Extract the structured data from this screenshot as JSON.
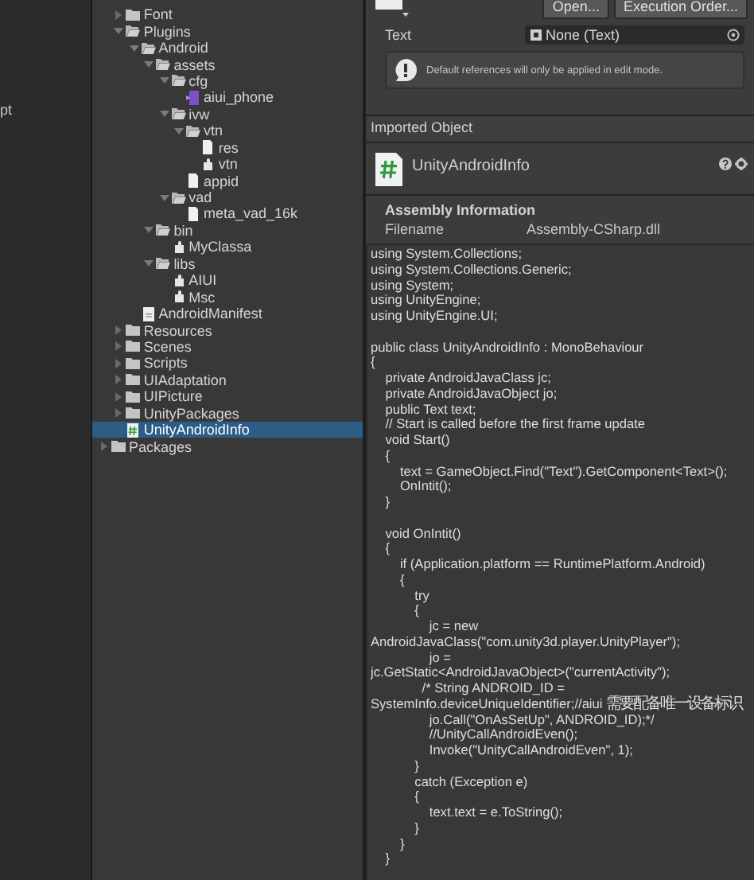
{
  "left_panel": {
    "text": "pt"
  },
  "tree": {
    "items": [
      {
        "label": "Font",
        "kind": "folder",
        "expanded": false,
        "selected": false
      },
      {
        "label": "Plugins",
        "kind": "folder",
        "expanded": true,
        "selected": false,
        "children": [
          {
            "label": "Android",
            "kind": "folder",
            "expanded": true,
            "selected": false,
            "children": [
              {
                "label": "assets",
                "kind": "folder",
                "expanded": true,
                "selected": false,
                "children": [
                  {
                    "label": "cfg",
                    "kind": "folder",
                    "expanded": true,
                    "selected": false,
                    "children": [
                      {
                        "label": "aiui_phone",
                        "kind": "vs-file",
                        "selected": false
                      }
                    ]
                  },
                  {
                    "label": "ivw",
                    "kind": "folder",
                    "expanded": true,
                    "selected": false,
                    "children": [
                      {
                        "label": "vtn",
                        "kind": "folder",
                        "expanded": true,
                        "selected": false,
                        "children": [
                          {
                            "label": "res",
                            "kind": "text-file",
                            "selected": false
                          },
                          {
                            "label": "vtn",
                            "kind": "plugin",
                            "selected": false
                          }
                        ]
                      },
                      {
                        "label": "appid",
                        "kind": "text-file",
                        "selected": false
                      }
                    ]
                  },
                  {
                    "label": "vad",
                    "kind": "folder",
                    "expanded": true,
                    "selected": false,
                    "children": [
                      {
                        "label": "meta_vad_16k",
                        "kind": "text-file",
                        "selected": false
                      }
                    ]
                  }
                ]
              },
              {
                "label": "bin",
                "kind": "folder",
                "expanded": true,
                "selected": false,
                "children": [
                  {
                    "label": "MyClassa",
                    "kind": "plugin",
                    "selected": false
                  }
                ]
              },
              {
                "label": "libs",
                "kind": "folder",
                "expanded": true,
                "selected": false,
                "children": [
                  {
                    "label": "AIUI",
                    "kind": "plugin",
                    "selected": false
                  },
                  {
                    "label": "Msc",
                    "kind": "plugin",
                    "selected": false
                  }
                ]
              }
            ]
          },
          {
            "label": "AndroidManifest",
            "kind": "manifest",
            "selected": false
          }
        ]
      },
      {
        "label": "Resources",
        "kind": "folder",
        "expanded": false,
        "selected": false
      },
      {
        "label": "Scenes",
        "kind": "folder",
        "expanded": false,
        "selected": false
      },
      {
        "label": "Scripts",
        "kind": "folder",
        "expanded": false,
        "selected": false
      },
      {
        "label": "UIAdaptation",
        "kind": "folder",
        "expanded": false,
        "selected": false
      },
      {
        "label": "UIPicture",
        "kind": "folder",
        "expanded": false,
        "selected": false
      },
      {
        "label": "UnityPackages",
        "kind": "folder",
        "expanded": false,
        "selected": false
      },
      {
        "label": "UnityAndroidInfo",
        "kind": "script",
        "selected": true
      }
    ],
    "root_items": [
      {
        "label": "Packages",
        "kind": "folder",
        "expanded": false,
        "selected": false
      }
    ]
  },
  "inspector": {
    "buttons": [
      "Open...",
      "Execution Order..."
    ],
    "field": {
      "label": "Text",
      "value": "None (Text)"
    },
    "help": "Default references will only be applied in edit mode.",
    "section_header": "Imported Object",
    "asset_name": "UnityAndroidInfo",
    "assembly": {
      "title": "Assembly Information",
      "label": "Filename",
      "value": "Assembly-CSharp.dll"
    },
    "code_blocks": [
      [
        "using System.Collections;",
        "using System.Collections.Generic;",
        "using System;",
        "using UnityEngine;",
        "using UnityEngine.UI;"
      ],
      [
        "public class UnityAndroidInfo : MonoBehaviour",
        "{",
        "    private AndroidJavaClass jc;",
        "    private AndroidJavaObject jo;",
        "    public Text text;",
        "    // Start is called before the first frame update",
        "    void Start()",
        "    {",
        "        text = GameObject.Find(\"Text\").GetComponent<Text>();",
        "        OnIntit();",
        "    }"
      ],
      [
        "    void OnIntit()",
        "    {",
        "        if (Application.platform == RuntimePlatform.Android)",
        "        {",
        "            try",
        "            {",
        "                jc = new",
        "AndroidJavaClass(\"com.unity3d.player.UnityPlayer\");",
        "                jo =",
        "jc.GetStatic<AndroidJavaObject>(\"currentActivity\");",
        "              /* String ANDROID_ID =",
        "SystemInfo.deviceUniqueIdentifier;//aiui 需要配备唯一设备标识",
        "                jo.Call(\"OnAsSetUp\", ANDROID_ID);*/",
        "                //UnityCallAndroidEven();",
        "                Invoke(\"UnityCallAndroidEven\", 1);",
        "            }",
        "            catch (Exception e)",
        "            {",
        "                text.text = e.ToString();",
        "            }",
        "        }",
        "    }"
      ]
    ]
  }
}
